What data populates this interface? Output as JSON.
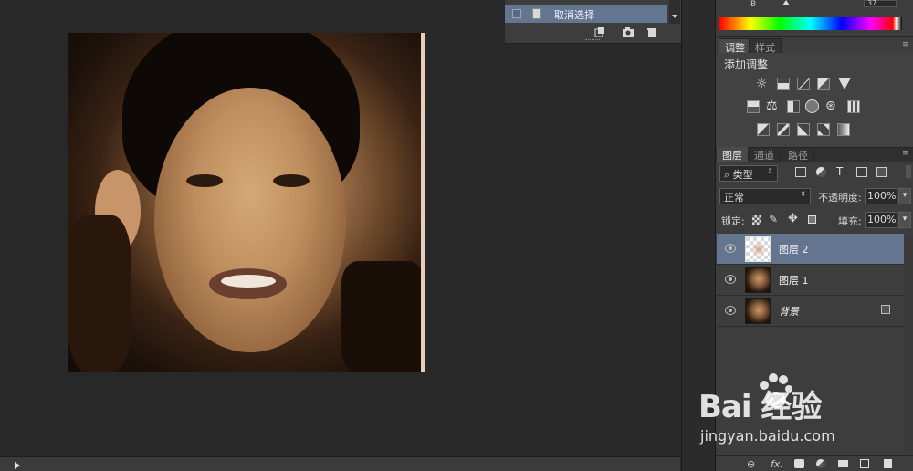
{
  "history": {
    "item_label": "取消选择",
    "tool_icons": [
      "new-snapshot-icon",
      "camera-icon",
      "trash-icon"
    ]
  },
  "color_panel": {
    "value": "37"
  },
  "tabs": [
    {
      "label": "调整",
      "active": true
    },
    {
      "label": "样式",
      "active": false
    }
  ],
  "adjustments": {
    "title": "添加调整"
  },
  "layers_tabs": [
    {
      "label": "图层",
      "active": true
    },
    {
      "label": "通道",
      "active": false
    },
    {
      "label": "路径",
      "active": false
    }
  ],
  "layers_panel": {
    "filter_label": "类型",
    "blend_mode": "正常",
    "opacity_label": "不透明度:",
    "opacity_value": "100%",
    "lock_label": "锁定:",
    "fill_label": "填充:",
    "fill_value": "100%"
  },
  "layers": [
    {
      "name": "图层 2",
      "selected": true,
      "thumb": "transparent-checker"
    },
    {
      "name": "图层 1",
      "selected": false,
      "thumb": "photo"
    },
    {
      "name": "背景",
      "selected": false,
      "thumb": "photo",
      "locked": true
    }
  ],
  "bottom_icons": [
    "link-icon",
    "fx-icon",
    "mask-icon",
    "adjustment-icon",
    "folder-icon",
    "new-layer-icon",
    "trash-icon"
  ],
  "bottom_fx_label": "fx.",
  "watermark": {
    "logo_text": "Bai  经验",
    "url": "jingyan.baidu.com"
  }
}
